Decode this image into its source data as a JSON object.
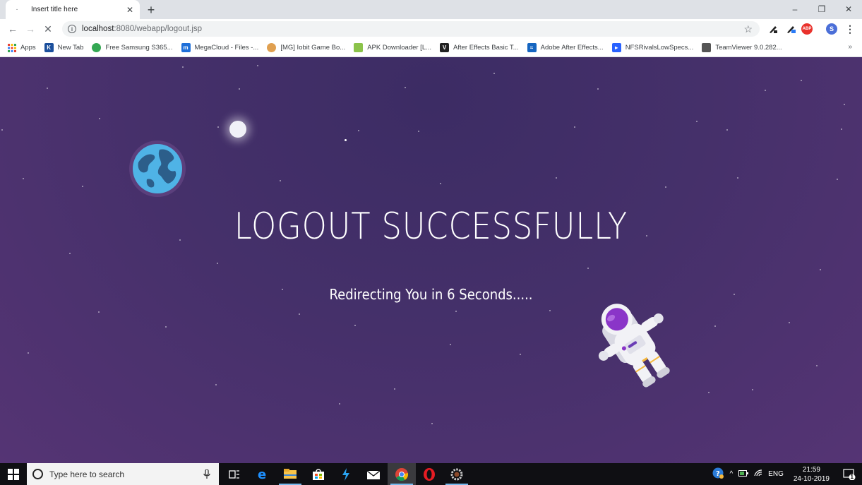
{
  "browser": {
    "tab": {
      "title": "Insert title here",
      "favicon": "loading-dot-icon"
    },
    "new_tab": "+",
    "window_controls": [
      "minimize-icon",
      "restore-icon",
      "close-icon"
    ],
    "url_host": "localhost",
    "url_rest": ":8080/webapp/logout.jsp",
    "bookmarks": [
      {
        "label": "Apps",
        "icon": "apps-grid-icon",
        "color": "#4285f4"
      },
      {
        "label": "New Tab",
        "icon": "k-logo-icon",
        "color": "#1b4f9c"
      },
      {
        "label": "Free Samsung S365...",
        "icon": "samsung-icon",
        "color": "#34a853"
      },
      {
        "label": "MegaCloud - Files -...",
        "icon": "megacloud-icon",
        "color": "#1e6fd9"
      },
      {
        "label": "[MG] Iobit Game Bo...",
        "icon": "iobit-icon",
        "color": "#e0a050"
      },
      {
        "label": "APK Downloader [L...",
        "icon": "apk-icon",
        "color": "#8bc34a"
      },
      {
        "label": "After Effects Basic T...",
        "icon": "v-logo-icon",
        "color": "#222222"
      },
      {
        "label": "Adobe After Effects...",
        "icon": "adobe-icon",
        "color": "#1565c0"
      },
      {
        "label": "NFSRivalsLowSpecs...",
        "icon": "nfs-icon",
        "color": "#2962ff"
      },
      {
        "label": "TeamViewer 9.0.282...",
        "icon": "teamviewer-icon",
        "color": "#555555"
      }
    ],
    "bookmarks_more": "»",
    "extension_abp": "ABP",
    "profile_initial": "S"
  },
  "page": {
    "headline": "LOGOUT SUCCESSFULLY",
    "subline": "Redirecting You in 6 Seconds.....",
    "colors": {
      "bg_top": "#3c2c64",
      "bg_bottom": "#553474",
      "earth": "#4fb3e6",
      "astronaut_visor": "#8a35c8"
    }
  },
  "taskbar": {
    "search_placeholder": "Type here to search",
    "apps": [
      "task-view-icon",
      "edge-icon",
      "file-explorer-icon",
      "store-icon",
      "vscode-icon",
      "mail-icon",
      "chrome-icon",
      "opera-icon",
      "settings-gear-icon"
    ],
    "tray_lang": "ENG",
    "time": "21:59",
    "date": "24-10-2019",
    "notification_count": "1"
  }
}
